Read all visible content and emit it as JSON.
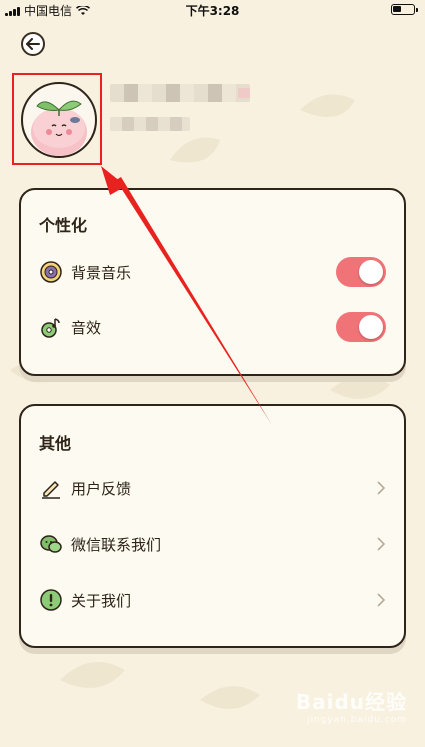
{
  "status_bar": {
    "carrier": "中国电信",
    "time": "下午3:28"
  },
  "profile": {
    "name_blurred": true
  },
  "personalize": {
    "title": "个性化",
    "items": [
      {
        "label": "背景音乐",
        "icon": "vinyl-record-icon",
        "enabled": true
      },
      {
        "label": "音效",
        "icon": "music-note-icon",
        "enabled": true
      }
    ]
  },
  "other": {
    "title": "其他",
    "items": [
      {
        "label": "用户反馈",
        "icon": "pencil-icon"
      },
      {
        "label": "微信联系我们",
        "icon": "wechat-icon"
      },
      {
        "label": "关于我们",
        "icon": "info-icon"
      }
    ]
  },
  "colors": {
    "background": "#f8f1df",
    "toggle_on": "#f07377",
    "annotation": "#e8231f",
    "card_border": "#2e2419"
  },
  "watermark": {
    "text": "Baidu经验",
    "sub": "jingyan.baidu.com"
  }
}
